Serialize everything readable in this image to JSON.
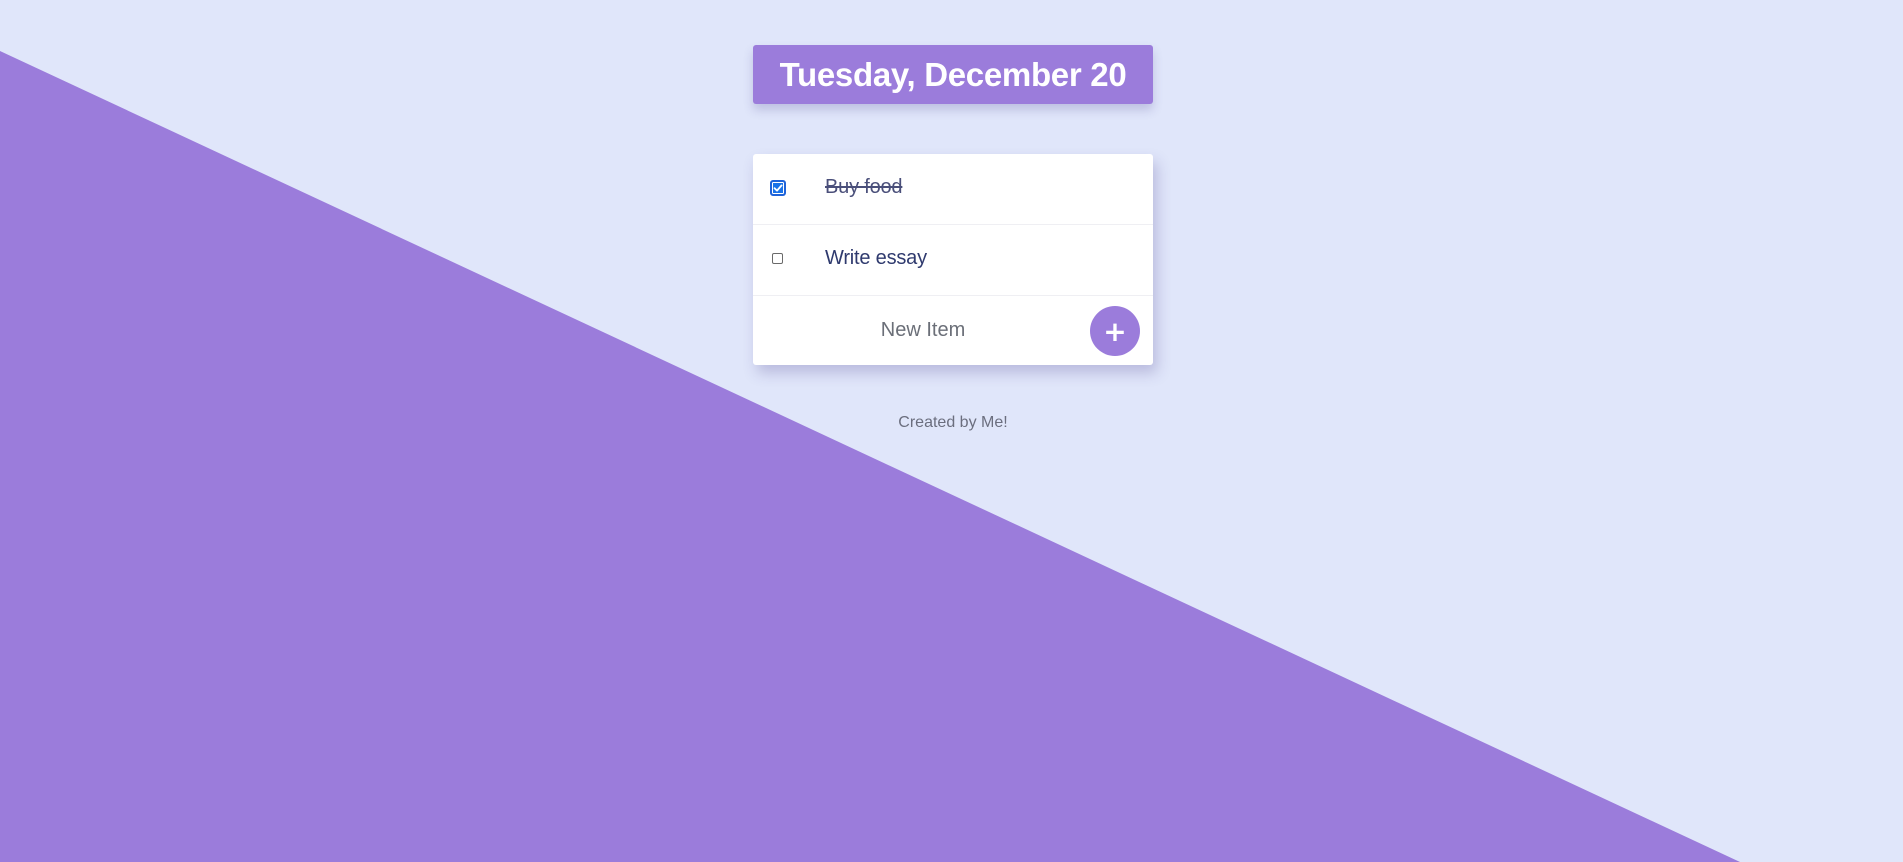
{
  "colors": {
    "background": "#E0E6FA",
    "accent": "#9B7CDB",
    "card": "#FFFFFF",
    "checkbox_checked": "#1A73E8"
  },
  "heading": {
    "date_text": "Tuesday, December 20"
  },
  "todo": {
    "items": [
      {
        "text": "Buy food",
        "checked": true
      },
      {
        "text": "Write essay",
        "checked": false
      }
    ],
    "new_item": {
      "placeholder": "New Item",
      "value": ""
    },
    "add_button": {
      "label": "+",
      "icon": "plus-icon"
    }
  },
  "footer": {
    "text": "Created by Me!"
  }
}
